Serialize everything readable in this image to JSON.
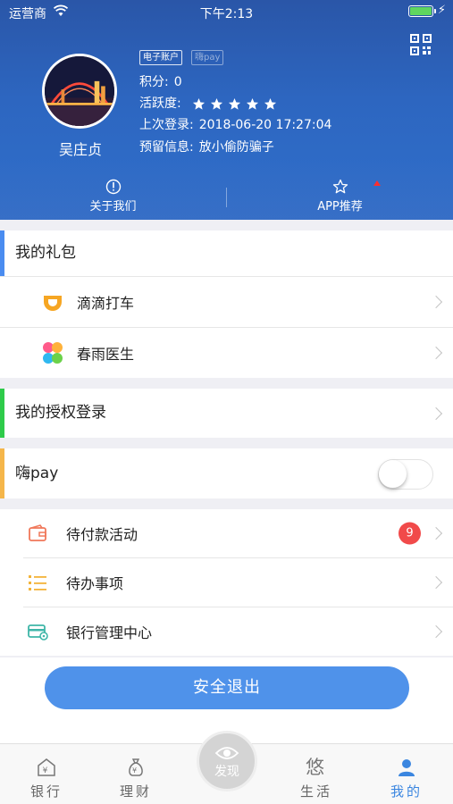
{
  "status_bar": {
    "carrier": "运营商",
    "time": "下午2:13"
  },
  "profile": {
    "name": "吴庄贞",
    "badges": [
      "电子账户",
      "嗨pay"
    ],
    "points_label": "积分:",
    "points_value": "0",
    "activity_label": "活跃度:",
    "activity_stars": 5,
    "last_login_label": "上次登录:",
    "last_login_value": "2018-06-20 17:27:04",
    "reserved_label": "预留信息:",
    "reserved_value": "放小偷防骗子"
  },
  "header_actions": {
    "about": "关于我们",
    "recommend": "APP推荐"
  },
  "gift_section": {
    "title": "我的礼包",
    "accent": "#4a8cf0",
    "items": [
      "滴滴打车",
      "春雨医生"
    ]
  },
  "auth_section": {
    "title": "我的授权登录",
    "accent": "#2ecb4a"
  },
  "hipay_section": {
    "title": "嗨pay",
    "accent": "#f5b64a",
    "toggle_on": false
  },
  "task_section": {
    "items": [
      {
        "label": "待付款活动",
        "badge": "9",
        "icon": "wallet-icon",
        "color": "#f0785a"
      },
      {
        "label": "待办事项",
        "icon": "list-icon",
        "color": "#f3b43a"
      },
      {
        "label": "银行管理中心",
        "icon": "card-settings-icon",
        "color": "#3fb6a8"
      }
    ]
  },
  "logout_label": "安全退出",
  "tabbar": {
    "bank": "银行",
    "finance": "理财",
    "discover": "发现",
    "life": "生活",
    "mine": "我的",
    "active_color": "#3b86e0"
  }
}
